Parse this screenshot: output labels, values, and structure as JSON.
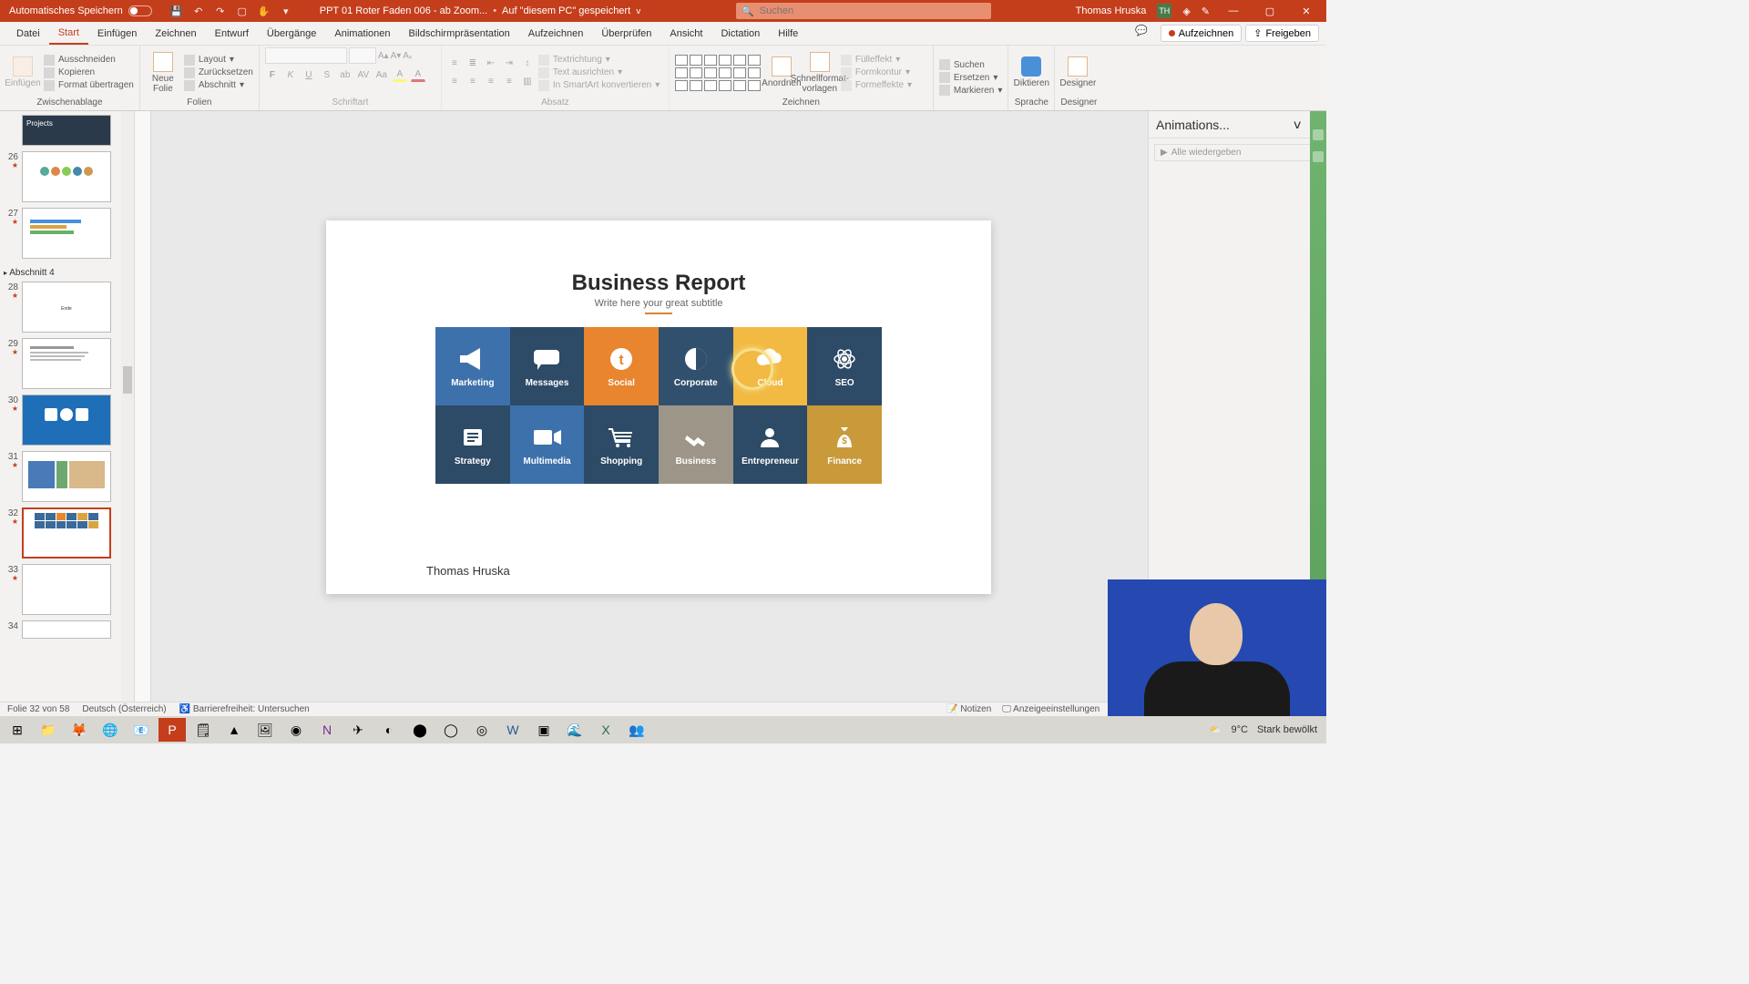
{
  "titlebar": {
    "autosave_label": "Automatisches Speichern",
    "doc_title": "PPT 01 Roter Faden 006 - ab Zoom...",
    "saved_hint": "Auf \"diesem PC\" gespeichert",
    "search_placeholder": "Suchen",
    "user_name": "Thomas Hruska",
    "user_initials": "TH"
  },
  "menu": {
    "tabs": [
      "Datei",
      "Start",
      "Einfügen",
      "Zeichnen",
      "Entwurf",
      "Übergänge",
      "Animationen",
      "Bildschirmpräsentation",
      "Aufzeichnen",
      "Überprüfen",
      "Ansicht",
      "Dictation",
      "Hilfe"
    ],
    "active_index": 1,
    "record_btn": "Aufzeichnen",
    "share_btn": "Freigeben"
  },
  "ribbon": {
    "clipboard": {
      "label": "Zwischenablage",
      "paste": "Einfügen",
      "cut": "Ausschneiden",
      "copy": "Kopieren",
      "format_painter": "Format übertragen"
    },
    "slides": {
      "label": "Folien",
      "new_slide": "Neue Folie",
      "layout": "Layout",
      "reset": "Zurücksetzen",
      "section": "Abschnitt"
    },
    "font": {
      "label": "Schriftart"
    },
    "paragraph": {
      "label": "Absatz",
      "text_dir": "Textrichtung",
      "align_text": "Text ausrichten",
      "smartart": "In SmartArt konvertieren"
    },
    "drawing": {
      "label": "Zeichnen",
      "arrange": "Anordnen",
      "quick_styles": "Schnellformat-vorlagen",
      "fill": "Fülleffekt",
      "outline": "Formkontur",
      "effects": "Formeffekte"
    },
    "editing": {
      "label": "",
      "find": "Suchen",
      "replace": "Ersetzen",
      "select": "Markieren"
    },
    "voice": {
      "label": "Sprache",
      "dictate": "Diktieren"
    },
    "designer": {
      "label": "Designer",
      "btn": "Designer"
    }
  },
  "thumbs": {
    "projects_label": "Projects",
    "items": [
      {
        "num": "26"
      },
      {
        "num": "27"
      },
      {
        "section": "Abschnitt 4"
      },
      {
        "num": "28",
        "label": "Ende"
      },
      {
        "num": "29"
      },
      {
        "num": "30"
      },
      {
        "num": "31"
      },
      {
        "num": "32",
        "selected": true
      },
      {
        "num": "33"
      },
      {
        "num": "34"
      }
    ]
  },
  "slide": {
    "title": "Business Report",
    "subtitle": "Write here your great subtitle",
    "tiles": [
      {
        "label": "Marketing",
        "cls": "c-blue1"
      },
      {
        "label": "Messages",
        "cls": "c-navy"
      },
      {
        "label": "Social",
        "cls": "c-orange"
      },
      {
        "label": "Corporate",
        "cls": "c-navy2"
      },
      {
        "label": "Cloud",
        "cls": "c-yellow"
      },
      {
        "label": "SEO",
        "cls": "c-navy3"
      },
      {
        "label": "Strategy",
        "cls": "c-navy4"
      },
      {
        "label": "Multimedia",
        "cls": "c-blue2"
      },
      {
        "label": "Shopping",
        "cls": "c-navy5"
      },
      {
        "label": "Business",
        "cls": "c-grey"
      },
      {
        "label": "Entrepreneur",
        "cls": "c-navy6"
      },
      {
        "label": "Finance",
        "cls": "c-gold"
      }
    ],
    "author": "Thomas Hruska"
  },
  "anim_pane": {
    "title": "Animations...",
    "play_all": "Alle wiedergeben"
  },
  "status": {
    "slide_counter": "Folie 32 von 58",
    "lang": "Deutsch (Österreich)",
    "accessibility": "Barrierefreiheit: Untersuchen",
    "notes": "Notizen",
    "display": "Anzeigeeinstellungen"
  },
  "taskbar": {
    "weather_temp": "9°C",
    "weather_desc": "Stark bewölkt"
  }
}
